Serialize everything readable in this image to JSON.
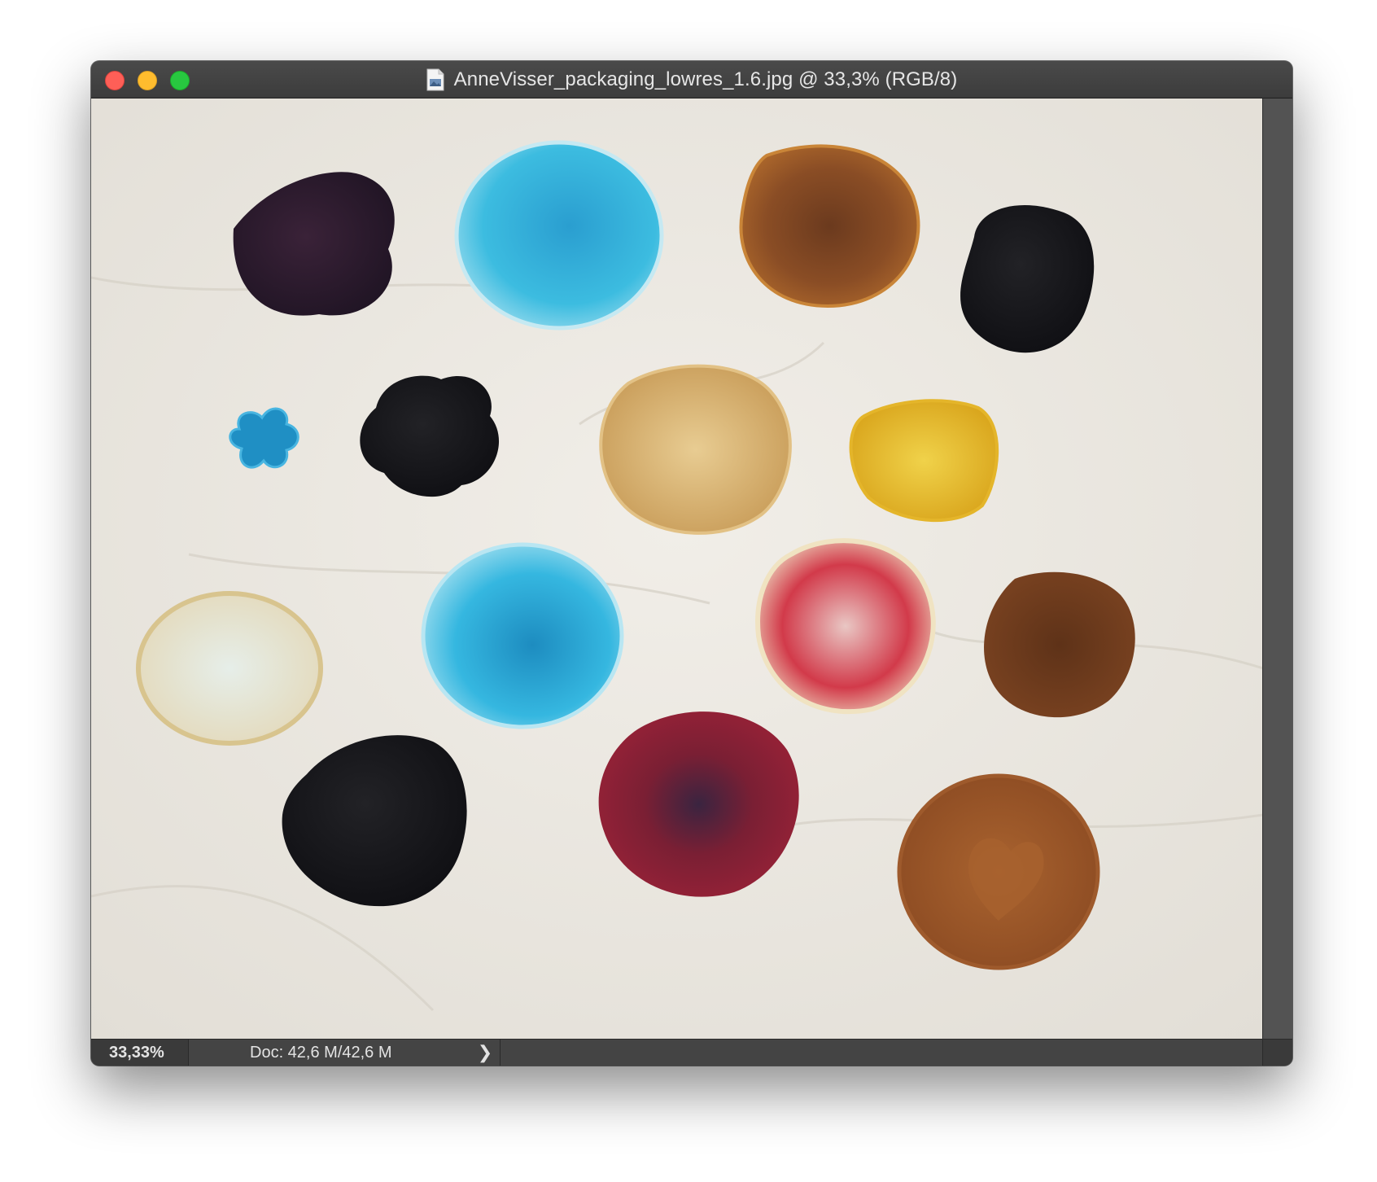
{
  "window": {
    "title": "AnneVisser_packaging_lowres_1.6.jpg @ 33,3% (RGB/8)"
  },
  "statusbar": {
    "zoom": "33,33%",
    "doc_info": "Doc: 42,6 M/42,6 M",
    "arrow": "❯"
  },
  "colors": {
    "close": "#fe5f57",
    "minimize": "#febc2e",
    "maximize": "#28c840",
    "titlebar": "#3c3c3c",
    "canvas_background": "#ebe8e1"
  }
}
